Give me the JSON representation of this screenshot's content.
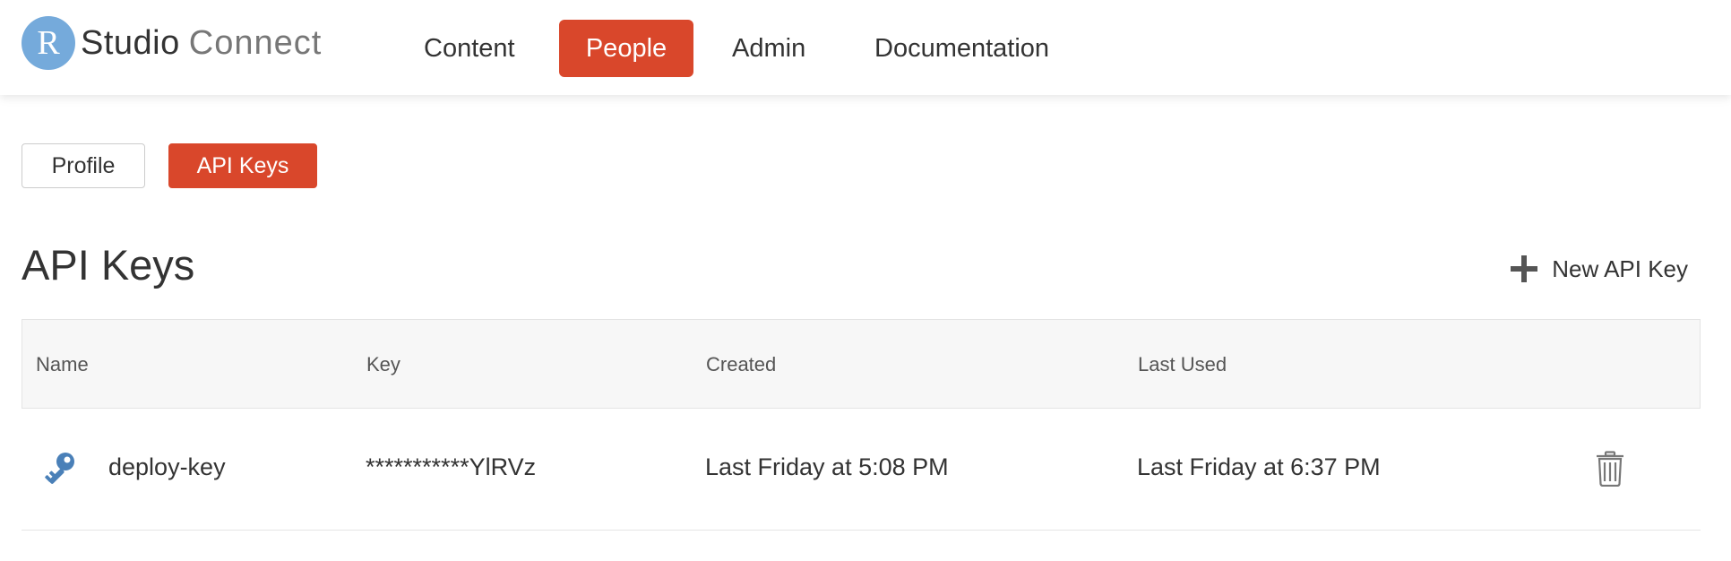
{
  "brand": {
    "logo_letter": "R",
    "name_main": "Studio",
    "name_sub": "Connect"
  },
  "nav": {
    "items": [
      {
        "label": "Content",
        "active": false
      },
      {
        "label": "People",
        "active": true
      },
      {
        "label": "Admin",
        "active": false
      },
      {
        "label": "Documentation",
        "active": false
      }
    ]
  },
  "tabs": [
    {
      "label": "Profile",
      "active": false
    },
    {
      "label": "API Keys",
      "active": true
    }
  ],
  "page": {
    "title": "API Keys",
    "new_key_label": "New API Key"
  },
  "table": {
    "columns": [
      "Name",
      "Key",
      "Created",
      "Last Used"
    ],
    "rows": [
      {
        "name": "deploy-key",
        "key": "***********YlRVz",
        "created": "Last Friday at 5:08 PM",
        "last_used": "Last Friday at 6:37 PM"
      }
    ]
  },
  "icons": {
    "logo": "r-logo-icon",
    "add": "plus-icon",
    "row_key": "key-icon",
    "delete": "trash-icon"
  },
  "colors": {
    "accent": "#d9472b",
    "logo_blue": "#75aadb",
    "key_icon_blue": "#4a80b8"
  }
}
